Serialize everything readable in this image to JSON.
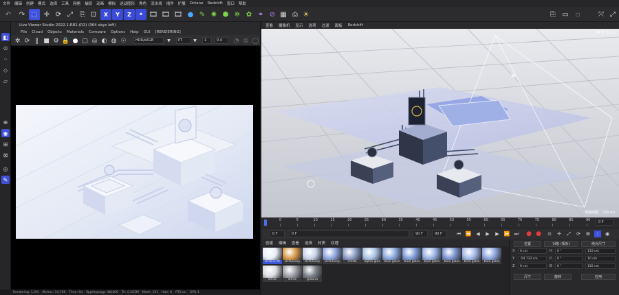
{
  "menubar": [
    "文件",
    "编辑",
    "创建",
    "模式",
    "选择",
    "工具",
    "网格",
    "捕捉",
    "动画",
    "模拟",
    "运动图形",
    "角色",
    "流水线",
    "插件",
    "扩展",
    "Octane",
    "Redshift",
    "窗口",
    "帮助"
  ],
  "toolbar": {
    "axis_labels": [
      "X",
      "Y",
      "Z"
    ],
    "right_icons": [
      "layout-icon",
      "save-icon",
      "maximize-icon",
      "expand-icon"
    ]
  },
  "live_viewer": {
    "title": "Live Viewer Studio 2022.1-R81-(R2) (364 days left)",
    "menu": [
      "File",
      "Cloud",
      "Objects",
      "Materials",
      "Compare",
      "Options",
      "Help",
      "GUI",
      "[RENDERING]"
    ],
    "color_space": "HDR/sRGB",
    "channel": "PT",
    "field_a": "1",
    "field_b": "0.4"
  },
  "status_bar": {
    "items": [
      "Rendering: 1.2%",
      "Ms/sec: 14.766",
      "Time: 0d",
      "Spp/maxspp: 46/400",
      "Tri: 0.263M",
      "Mesh: 151",
      "Hair: 0",
      "RTX:on",
      "GPU:1"
    ]
  },
  "viewport": {
    "menu": [
      "查看",
      "摄像机",
      "显示",
      "选项",
      "过滤",
      "面板",
      "Redshift"
    ],
    "corner_label": "网格间距 : 100 cm"
  },
  "timeline": {
    "ticks": [
      "0",
      "5",
      "10",
      "15",
      "20",
      "25",
      "30",
      "35",
      "40",
      "45",
      "50",
      "55",
      "60",
      "65",
      "70",
      "75",
      "80",
      "85",
      "90"
    ],
    "current_frame": "0 F"
  },
  "transport": {
    "start": "0 F",
    "current": "0 F",
    "end_a": "90 F",
    "end_b": "90 F"
  },
  "material_manager": {
    "menu": [
      "创建",
      "编辑",
      "查看",
      "选择",
      "材质",
      "纹理"
    ],
    "materials": [
      {
        "label": "Octane Mi",
        "color": "#e8eef8",
        "selected": true
      },
      {
        "label": "OctGlossy",
        "color": "#d79a4a"
      },
      {
        "label": "OctGlossy",
        "color": "#c9d4ea"
      },
      {
        "label": "OctGlossy",
        "color": "#8fa6df"
      },
      {
        "label": "metal",
        "color": "#8a9bc4"
      },
      {
        "label": "alpha glas",
        "color": "#a9c2e2"
      },
      {
        "label": "blue glass",
        "color": "#8aa8dd"
      },
      {
        "label": "blue glass",
        "color": "#7f9bd6"
      },
      {
        "label": "blue glass",
        "color": "#96b0e4"
      },
      {
        "label": "blue glass",
        "color": "#7a93cf"
      },
      {
        "label": "blue glass",
        "color": "#a2b8e6"
      },
      {
        "label": "blue glass",
        "color": "#8ca5dc"
      },
      {
        "label": "white",
        "color": "#d9dbe0"
      },
      {
        "label": "white",
        "color": "#9c9fa6"
      },
      {
        "label": "ground",
        "color": "#7c8189"
      }
    ]
  },
  "coordinates": {
    "headers": [
      "位置",
      "尺寸",
      "旋转"
    ],
    "rows": [
      {
        "axis": "X",
        "pos": "0 cm",
        "rot_label": "H",
        "rot": "0 °",
        "size": "150 cm"
      },
      {
        "axis": "Y",
        "pos": "-54.733 cm",
        "rot_label": "P",
        "rot": "0 °",
        "size": "10 cm"
      },
      {
        "axis": "Z",
        "pos": "0 cm",
        "rot_label": "B",
        "rot": "0 °",
        "size": "150 cm"
      }
    ],
    "mode_select": "对象 (相对)",
    "size_select": "绝对尺寸",
    "apply_label": "应用"
  },
  "colors": {
    "accent": "#3d52e0",
    "record": "#e23b3b",
    "viewport_floor": "#c7c9d2"
  }
}
